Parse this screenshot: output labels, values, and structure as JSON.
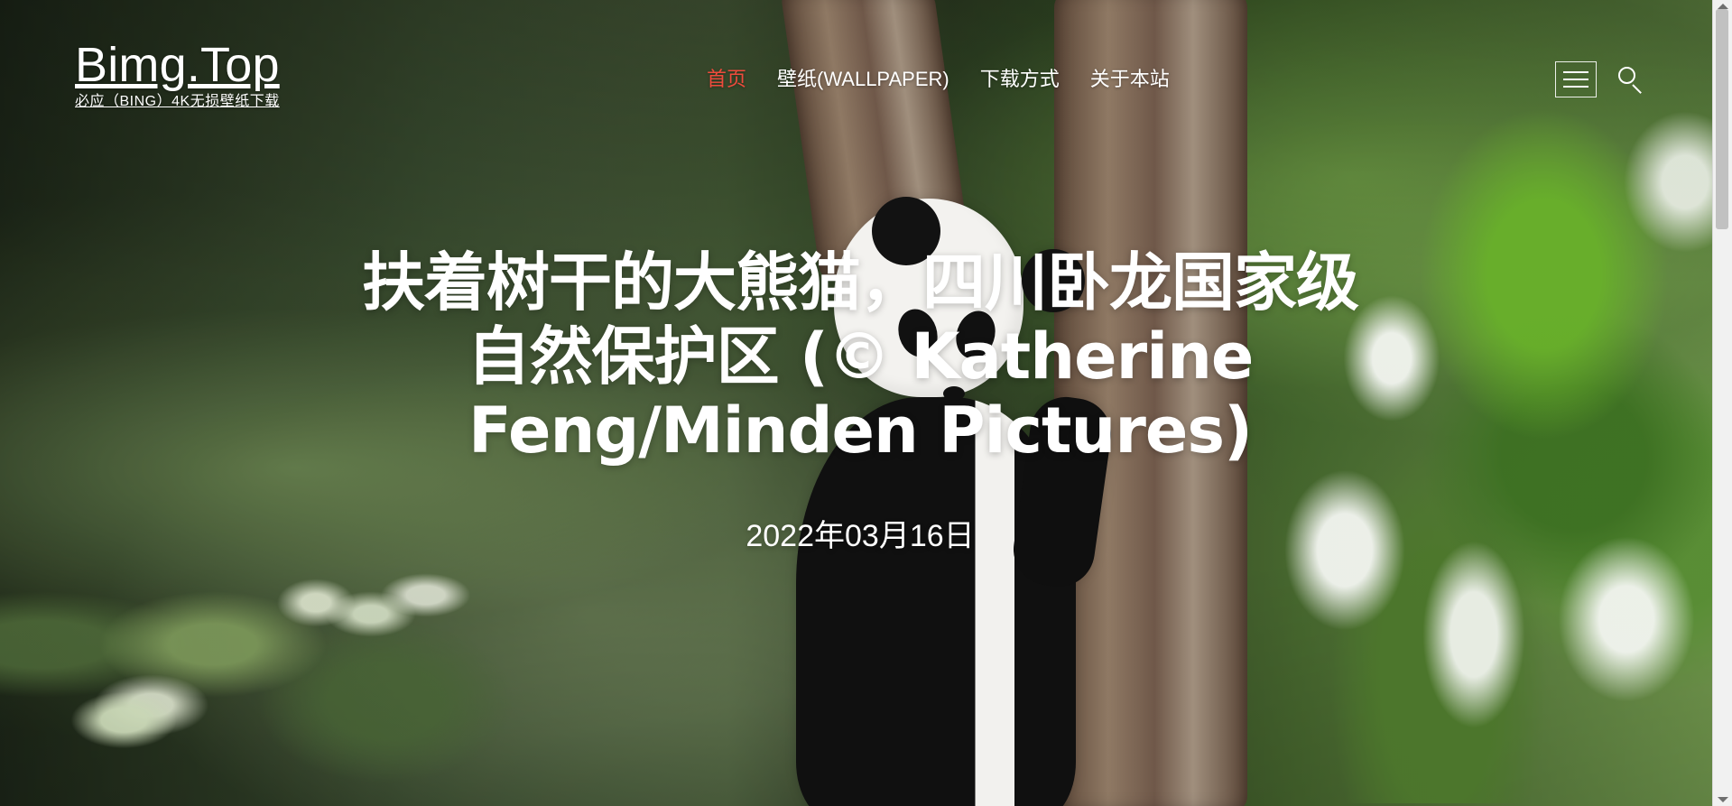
{
  "site": {
    "title": "Bimg.Top",
    "subtitle": "必应（BING）4K无损壁纸下载"
  },
  "nav": {
    "items": [
      {
        "label": "首页",
        "active": true
      },
      {
        "label": "壁纸(WALLPAPER)",
        "active": false
      },
      {
        "label": "下载方式",
        "active": false
      },
      {
        "label": "关于本站",
        "active": false
      }
    ]
  },
  "hero": {
    "title": "扶着树干的大熊猫，四川卧龙国家级自然保护区 (© Katherine Feng/Minden Pictures)",
    "date": "2022年03月16日"
  },
  "icons": {
    "menu": "menu-icon",
    "search": "search-icon"
  },
  "colors": {
    "active_nav": "#ef4b3c",
    "text": "#ffffff"
  }
}
